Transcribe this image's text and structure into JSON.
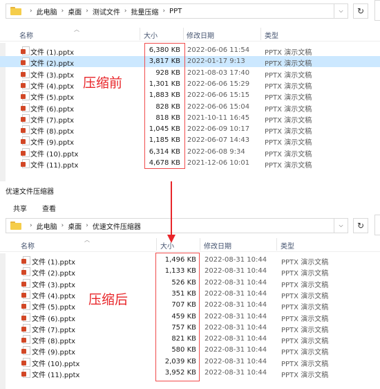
{
  "top": {
    "breadcrumb": [
      "此电脑",
      "桌面",
      "测试文件",
      "批量压缩",
      "PPT"
    ],
    "columns": {
      "name": "名称",
      "size": "大小",
      "date": "修改日期",
      "type": "类型"
    },
    "files": [
      {
        "name": "文件 (1).pptx",
        "size": "6,380 KB",
        "date": "2022-06-06 11:54",
        "type": "PPTX 演示文稿"
      },
      {
        "name": "文件 (2).pptx",
        "size": "3,817 KB",
        "date": "2022-01-17 9:13",
        "type": "PPTX 演示文稿",
        "selected": true
      },
      {
        "name": "文件 (3).pptx",
        "size": "928 KB",
        "date": "2021-08-03 17:40",
        "type": "PPTX 演示文稿"
      },
      {
        "name": "文件 (4).pptx",
        "size": "1,301 KB",
        "date": "2022-06-06 15:29",
        "type": "PPTX 演示文稿"
      },
      {
        "name": "文件 (5).pptx",
        "size": "1,883 KB",
        "date": "2022-06-06 15:15",
        "type": "PPTX 演示文稿"
      },
      {
        "name": "文件 (6).pptx",
        "size": "828 KB",
        "date": "2022-06-06 15:04",
        "type": "PPTX 演示文稿"
      },
      {
        "name": "文件 (7).pptx",
        "size": "818 KB",
        "date": "2021-10-11 16:45",
        "type": "PPTX 演示文稿"
      },
      {
        "name": "文件 (8).pptx",
        "size": "1,045 KB",
        "date": "2022-06-09 10:17",
        "type": "PPTX 演示文稿"
      },
      {
        "name": "文件 (9).pptx",
        "size": "1,185 KB",
        "date": "2022-06-07 14:43",
        "type": "PPTX 演示文稿"
      },
      {
        "name": "文件 (10).pptx",
        "size": "6,314 KB",
        "date": "2022-06-08 9:34",
        "type": "PPTX 演示文稿"
      },
      {
        "name": "文件 (11).pptx",
        "size": "4,678 KB",
        "date": "2021-12-06 10:01",
        "type": "PPTX 演示文稿"
      }
    ],
    "annotation": "压缩前"
  },
  "bottom": {
    "window_title": "优速文件压缩器",
    "ribbon_tabs": [
      "共享",
      "查看"
    ],
    "breadcrumb": [
      "此电脑",
      "桌面",
      "优速文件压缩器"
    ],
    "columns": {
      "name": "名称",
      "size": "大小",
      "date": "修改日期",
      "type": "类型"
    },
    "files": [
      {
        "name": "文件 (1).pptx",
        "size": "1,496 KB",
        "date": "2022-08-31 10:44",
        "type": "PPTX 演示文稿"
      },
      {
        "name": "文件 (2).pptx",
        "size": "1,133 KB",
        "date": "2022-08-31 10:44",
        "type": "PPTX 演示文稿"
      },
      {
        "name": "文件 (3).pptx",
        "size": "526 KB",
        "date": "2022-08-31 10:44",
        "type": "PPTX 演示文稿"
      },
      {
        "name": "文件 (4).pptx",
        "size": "351 KB",
        "date": "2022-08-31 10:44",
        "type": "PPTX 演示文稿"
      },
      {
        "name": "文件 (5).pptx",
        "size": "707 KB",
        "date": "2022-08-31 10:44",
        "type": "PPTX 演示文稿"
      },
      {
        "name": "文件 (6).pptx",
        "size": "459 KB",
        "date": "2022-08-31 10:44",
        "type": "PPTX 演示文稿"
      },
      {
        "name": "文件 (7).pptx",
        "size": "757 KB",
        "date": "2022-08-31 10:44",
        "type": "PPTX 演示文稿"
      },
      {
        "name": "文件 (8).pptx",
        "size": "821 KB",
        "date": "2022-08-31 10:44",
        "type": "PPTX 演示文稿"
      },
      {
        "name": "文件 (9).pptx",
        "size": "580 KB",
        "date": "2022-08-31 10:44",
        "type": "PPTX 演示文稿"
      },
      {
        "name": "文件 (10).pptx",
        "size": "2,039 KB",
        "date": "2022-08-31 10:44",
        "type": "PPTX 演示文稿"
      },
      {
        "name": "文件 (11).pptx",
        "size": "3,952 KB",
        "date": "2022-08-31 10:44",
        "type": "PPTX 演示文稿"
      }
    ],
    "annotation": "压缩后"
  },
  "icons": {
    "folder": "folder-icon",
    "pptx": "pptx-file-icon",
    "refresh": "refresh-icon",
    "dropdown": "chevron-down-icon",
    "breadcrumb_sep": "chevron-right-icon",
    "sort": "sort-caret-icon"
  },
  "colors": {
    "selection": "#cce8ff",
    "annotation_red": "#e8262a",
    "folder_yellow": "#f5cd4a",
    "pptx_orange": "#d24726"
  }
}
